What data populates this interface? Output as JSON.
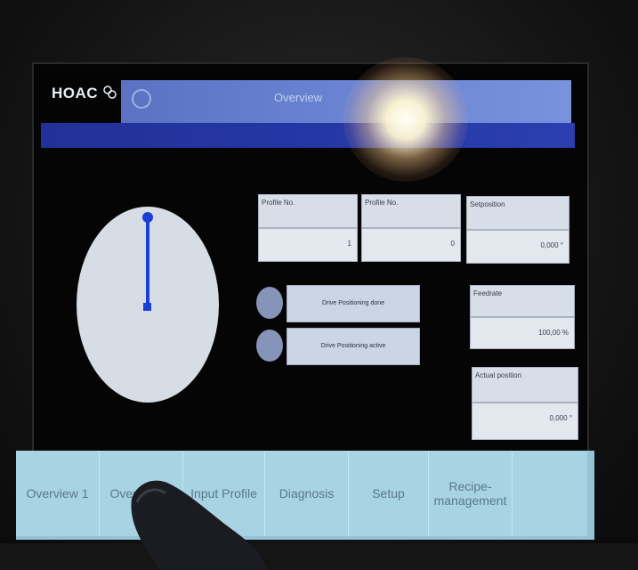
{
  "app": {
    "logo_text": "HOAC",
    "page_title": "Overview"
  },
  "gauge": {
    "position_fraction": 0.0
  },
  "fields": {
    "profile_no_1": {
      "label": "Profile No.",
      "value": "1"
    },
    "profile_no_2": {
      "label": "Profile No.",
      "value": "0"
    },
    "setpoint": {
      "label": "Setposition",
      "value": "0,000 °"
    },
    "feedrate": {
      "label": "Feedrate",
      "value": "100,00 %"
    },
    "actual_position": {
      "label": "Actual position",
      "value": "0,000 °"
    }
  },
  "status": {
    "done": {
      "label": "Drive Positioning done"
    },
    "active": {
      "label": "Drive Positioning active"
    }
  },
  "tabs": [
    {
      "label": "Overview 1"
    },
    {
      "label": "Overview 2"
    },
    {
      "label": "Input Profile"
    },
    {
      "label": "Diagnosis"
    },
    {
      "label": "Setup"
    },
    {
      "label": "Recipe-management"
    },
    {
      "label": ""
    }
  ],
  "colors": {
    "title_band": "#6a84d3",
    "nav_strip": "#2538a6",
    "tab_bg": "#a7d3e3",
    "needle": "#1a3fd6"
  }
}
